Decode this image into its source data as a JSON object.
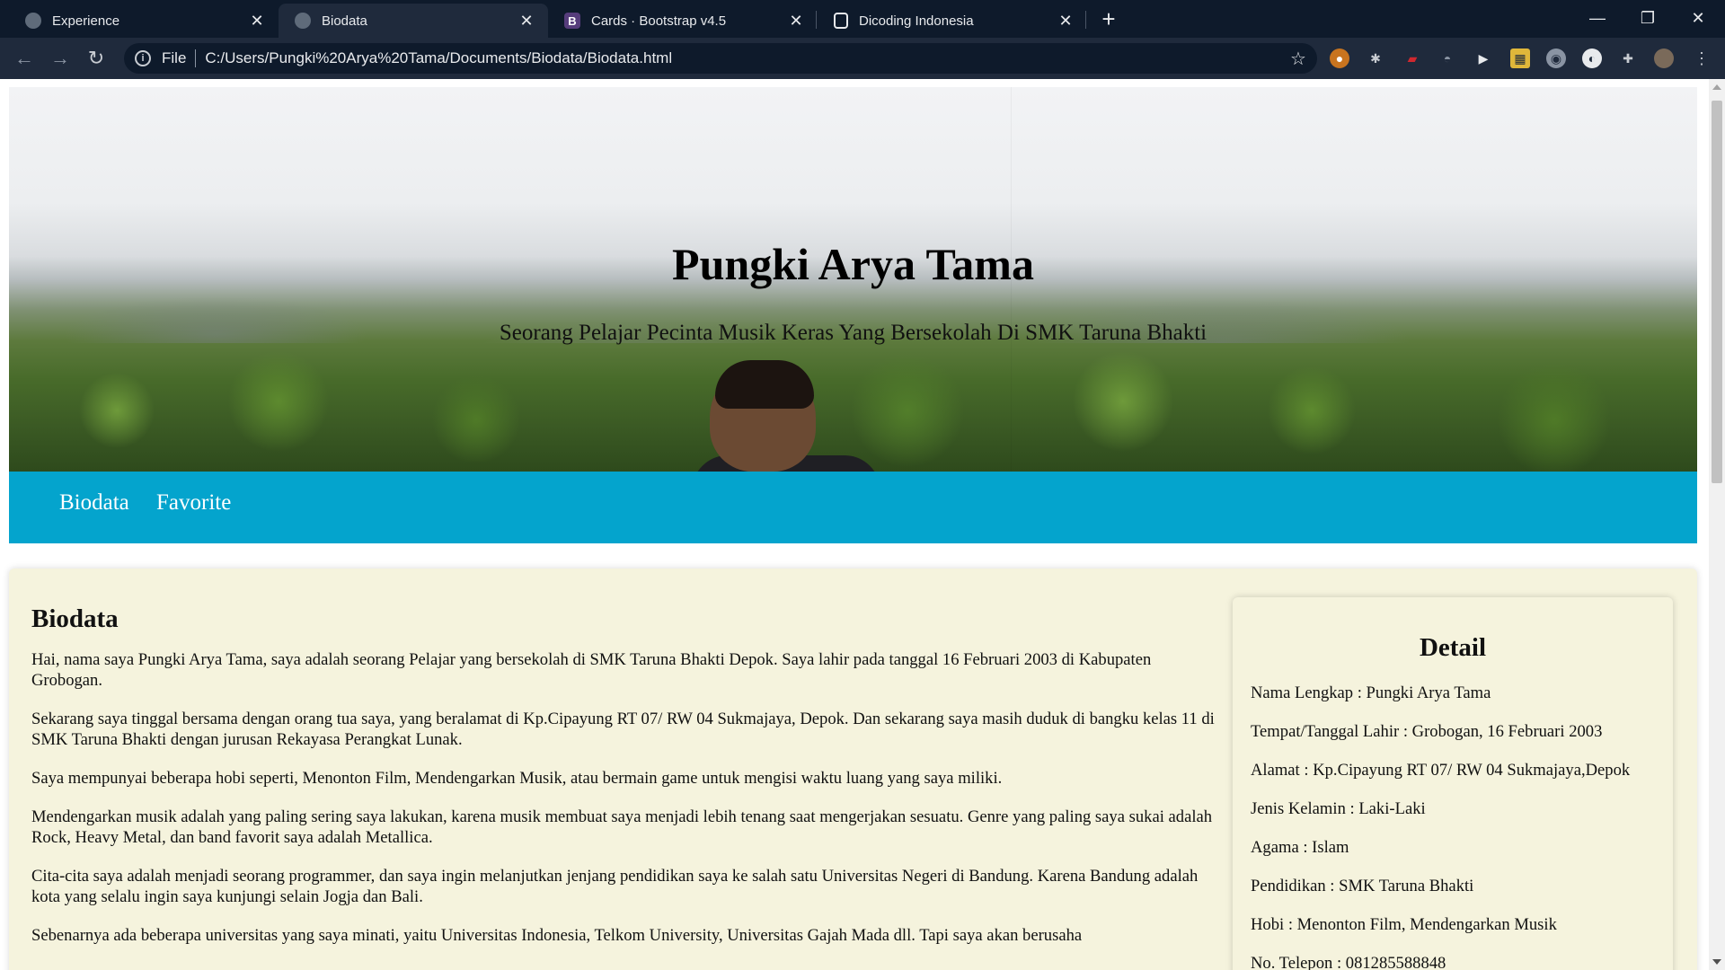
{
  "browser": {
    "tabs": [
      {
        "title": "Experience",
        "icon": "globe-icon",
        "active": false
      },
      {
        "title": "Biodata",
        "icon": "globe-icon",
        "active": true
      },
      {
        "title": "Cards · Bootstrap v4.5",
        "icon": "bootstrap-icon",
        "active": false
      },
      {
        "title": "Dicoding Indonesia",
        "icon": "dicoding-icon",
        "active": false
      }
    ],
    "address": {
      "scheme": "File",
      "url": "C:/Users/Pungki%20Arya%20Tama/Documents/Biodata/Biodata.html"
    }
  },
  "page": {
    "hero": {
      "title": "Pungki Arya Tama",
      "subtitle": "Seorang Pelajar Pecinta Musik Keras Yang Bersekolah Di SMK Taruna Bhakti"
    },
    "nav": {
      "links": [
        "Biodata",
        "Favorite"
      ]
    },
    "bio": {
      "heading": "Biodata",
      "paragraphs": [
        "Hai, nama saya Pungki Arya Tama, saya adalah seorang Pelajar yang bersekolah di SMK Taruna Bhakti Depok. Saya lahir pada tanggal 16 Februari 2003 di Kabupaten Grobogan.",
        "Sekarang saya tinggal bersama dengan orang tua saya, yang beralamat di Kp.Cipayung RT 07/ RW 04 Sukmajaya, Depok. Dan sekarang saya masih duduk di bangku kelas 11 di SMK Taruna Bhakti dengan jurusan Rekayasa Perangkat Lunak.",
        "Saya mempunyai beberapa hobi seperti, Menonton Film, Mendengarkan Musik, atau bermain game untuk mengisi waktu luang yang saya miliki.",
        "Mendengarkan musik adalah yang paling sering saya lakukan, karena musik membuat saya menjadi lebih tenang saat mengerjakan sesuatu. Genre yang paling saya sukai adalah Rock, Heavy Metal, dan band favorit saya adalah Metallica.",
        "Cita-cita saya adalah menjadi seorang programmer, dan saya ingin melanjutkan jenjang pendidikan saya ke salah satu Universitas Negeri di Bandung. Karena Bandung adalah kota yang selalu ingin saya kunjungi selain Jogja dan Bali.",
        "Sebenarnya ada beberapa universitas yang saya minati, yaitu Universitas Indonesia, Telkom University, Universitas Gajah Mada dll. Tapi saya akan berusaha"
      ]
    },
    "detail": {
      "heading": "Detail",
      "rows": [
        "Nama Lengkap : Pungki Arya Tama",
        "Tempat/Tanggal Lahir : Grobogan, 16 Februari 2003",
        "Alamat : Kp.Cipayung RT 07/ RW 04 Sukmajaya,Depok",
        "Jenis Kelamin : Laki-Laki",
        "Agama : Islam",
        "Pendidikan : SMK Taruna Bhakti",
        "Hobi : Menonton Film, Mendengarkan Musik",
        "No. Telepon : 081285588848"
      ]
    }
  },
  "colors": {
    "nav_band": "#04a4cd",
    "panel_bg": "#f5f3dd",
    "chrome_dark": "#0e1a2b",
    "chrome_toolbar": "#1f2a3c"
  }
}
